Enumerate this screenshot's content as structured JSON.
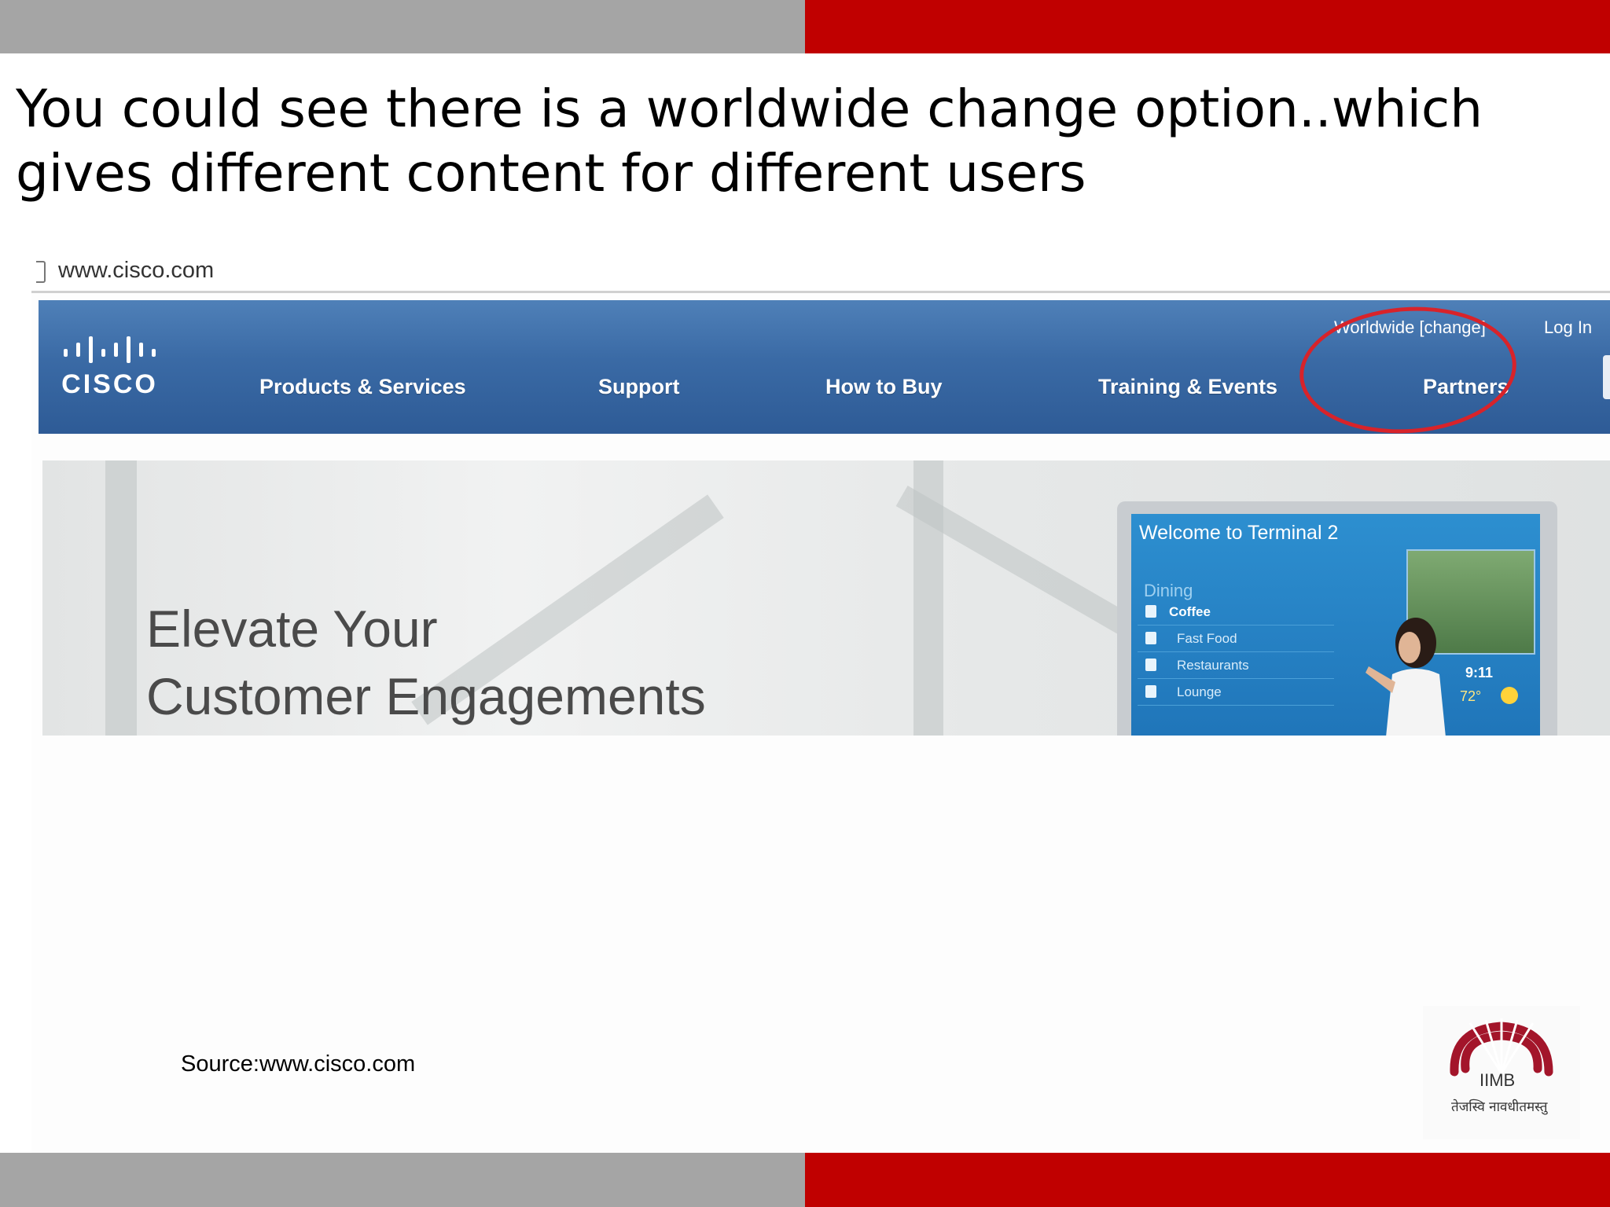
{
  "slide": {
    "title": "You could see there is a worldwide change option..which gives different content for different users",
    "source": "Source:www.cisco.com"
  },
  "browser": {
    "url": "www.cisco.com"
  },
  "cisco_site": {
    "logo_text": "CISCO",
    "utility_links": [
      "Worldwide [change]",
      "Log In"
    ],
    "nav_items": [
      "Products & Services",
      "Support",
      "How to Buy",
      "Training & Events",
      "Partners"
    ],
    "hero": {
      "headline_line1": "Elevate Your",
      "headline_line2": "Customer Engagements",
      "kiosk": {
        "title": "Welcome to Terminal 2",
        "menu_heading": "Dining",
        "menu_items": [
          "Coffee",
          "Fast Food",
          "Restaurants",
          "Lounge"
        ],
        "time": "9:11",
        "temp": "72°"
      }
    }
  },
  "iimb": {
    "abbr": "IIMB",
    "motto": "तेजस्वि नावधीतमस्तु"
  },
  "colors": {
    "bar_gray": "#a5a5a5",
    "bar_red": "#c00000",
    "cisco_blue": "#3a6aa5",
    "highlight_red": "#d8232a"
  }
}
